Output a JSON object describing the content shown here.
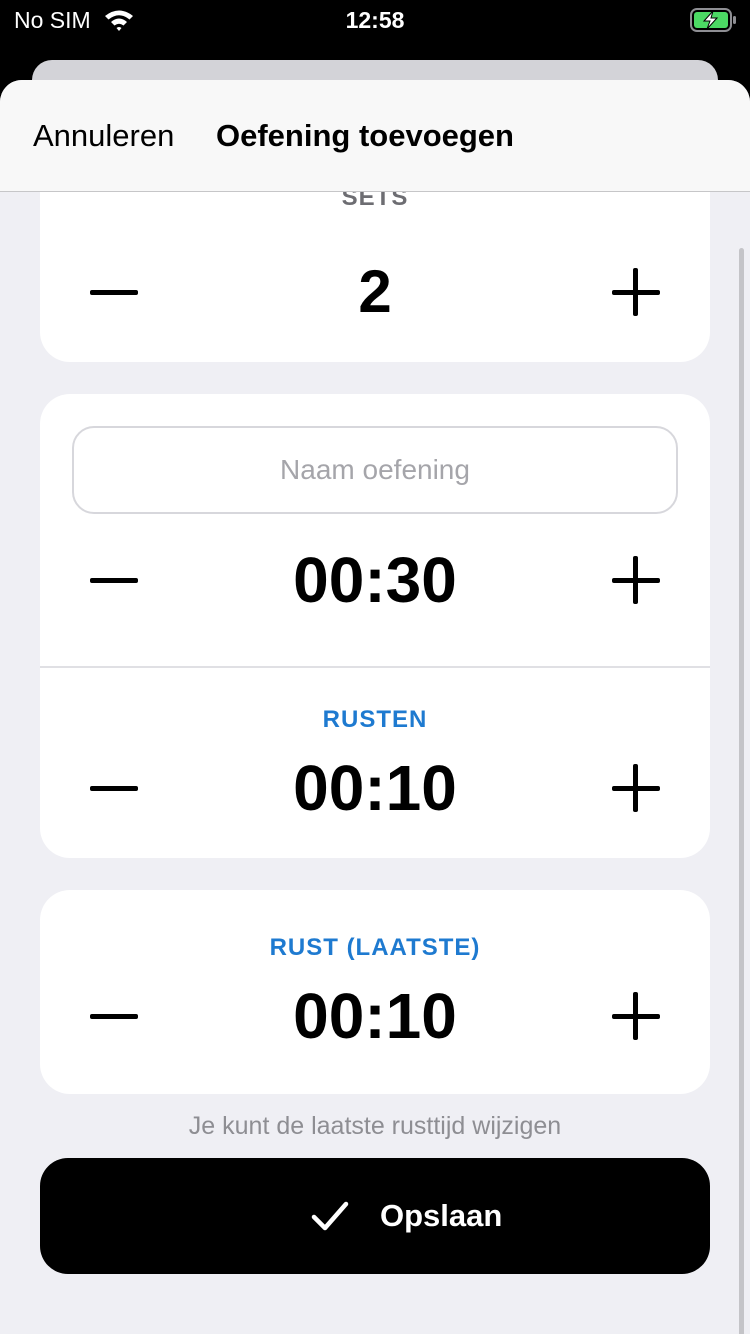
{
  "status_bar": {
    "carrier": "No SIM",
    "time": "12:58",
    "wifi_icon": "wifi-icon",
    "battery_icon": "battery-charging-icon"
  },
  "nav": {
    "cancel_label": "Annuleren",
    "title": "Oefening toevoegen"
  },
  "sets": {
    "label": "SETS",
    "value": "2"
  },
  "exercise": {
    "name_placeholder": "Naam oefening",
    "name_value": "",
    "duration": "00:30"
  },
  "rest": {
    "label": "RUSTEN",
    "value": "00:10"
  },
  "last_rest": {
    "label": "RUST (LAATSTE)",
    "value": "00:10"
  },
  "hint": "Je kunt de laatste rusttijd wijzigen",
  "save": {
    "label": "Opslaan",
    "icon": "checkmark-icon"
  },
  "colors": {
    "accent": "#1e7ad0",
    "background": "#efeff4",
    "battery": "#4cd964"
  }
}
